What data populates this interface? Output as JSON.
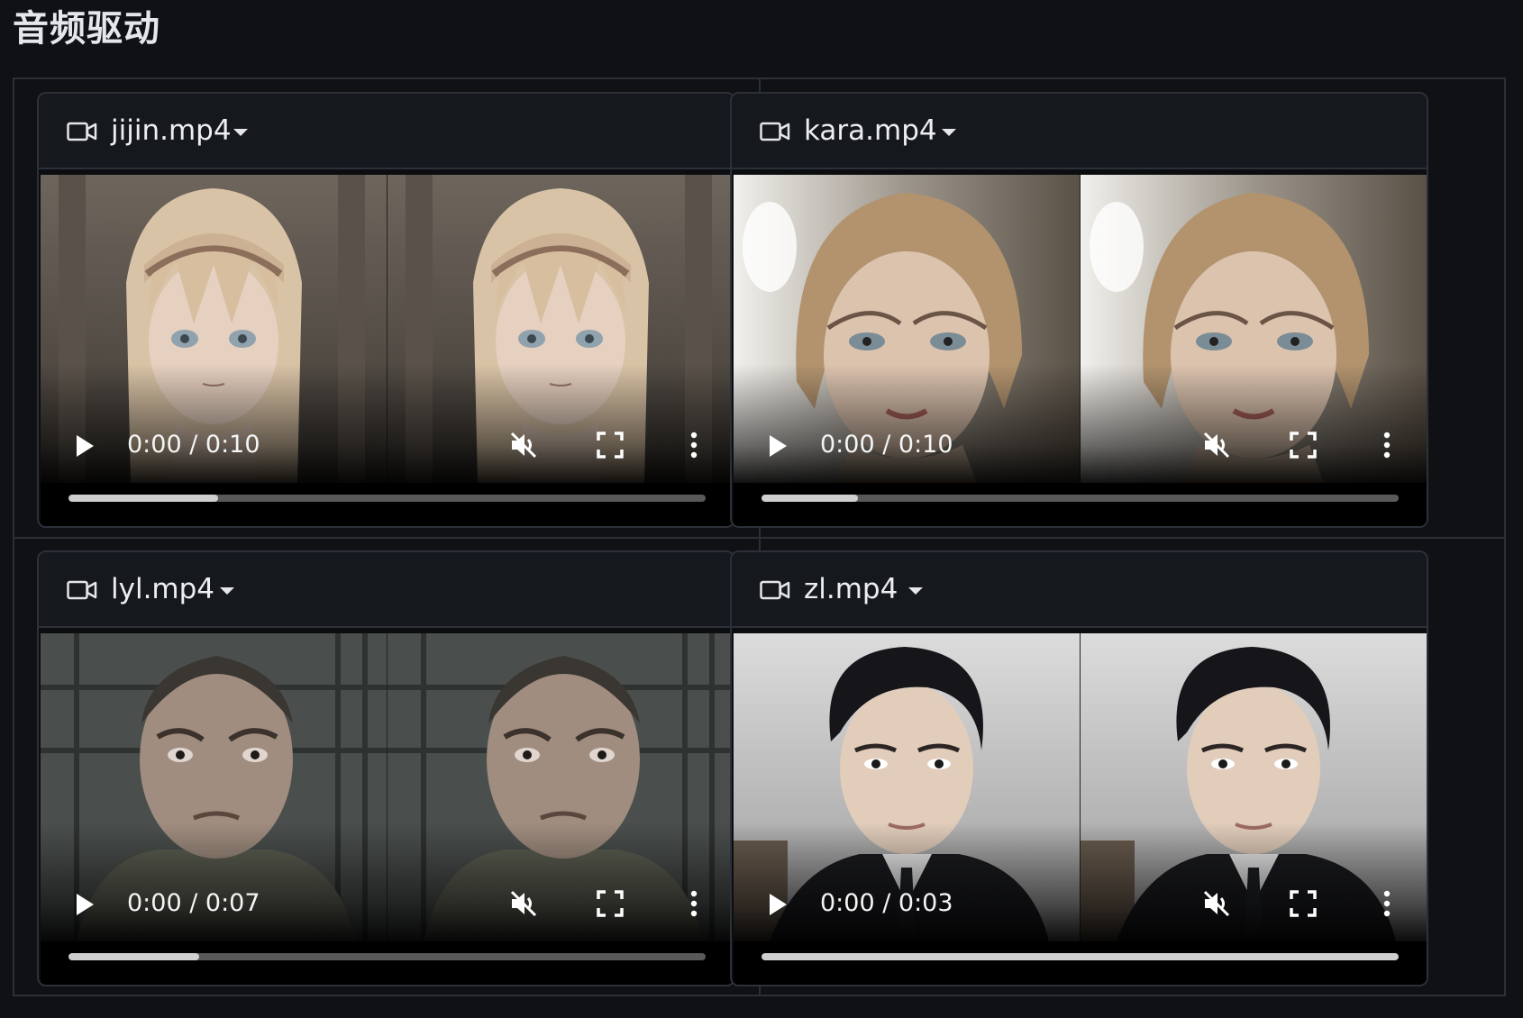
{
  "section": {
    "title": "音频驱动"
  },
  "cards": [
    {
      "filename": "jijin.mp4",
      "time": "0:00 / 0:10",
      "progress": 0.235,
      "theme": "anime",
      "icons": {
        "camera": "video-camera-icon",
        "dropdown": "caret-down-icon",
        "play": "play-icon",
        "mute": "volume-muted-icon",
        "fullscreen": "fullscreen-icon",
        "more": "more-vertical-icon"
      }
    },
    {
      "filename": "kara.mp4",
      "time": "0:00 / 0:10",
      "progress": 0.152,
      "theme": "woman",
      "icons": {
        "camera": "video-camera-icon",
        "dropdown": "caret-down-icon",
        "play": "play-icon",
        "mute": "volume-muted-icon",
        "fullscreen": "fullscreen-icon",
        "more": "more-vertical-icon"
      }
    },
    {
      "filename": "lyl.mp4",
      "time": "0:00 / 0:07",
      "progress": 0.205,
      "theme": "older-man",
      "icons": {
        "camera": "video-camera-icon",
        "dropdown": "caret-down-icon",
        "play": "play-icon",
        "mute": "volume-muted-icon",
        "fullscreen": "fullscreen-icon",
        "more": "more-vertical-icon"
      }
    },
    {
      "filename": "zl.mp4",
      "time": "0:00 / 0:03",
      "progress": 1.0,
      "theme": "suited-man",
      "icons": {
        "camera": "video-camera-icon",
        "dropdown": "caret-down-icon",
        "play": "play-icon",
        "mute": "volume-muted-icon",
        "fullscreen": "fullscreen-icon",
        "more": "more-vertical-icon"
      }
    }
  ],
  "colors": {
    "page_bg": "#0f1115",
    "card_header_bg": "#15181d",
    "border": "#2c3038",
    "text": "#eceef1",
    "progress_track": "rgba(255,255,255,0.35)",
    "progress_fill": "#cfcfcf"
  }
}
